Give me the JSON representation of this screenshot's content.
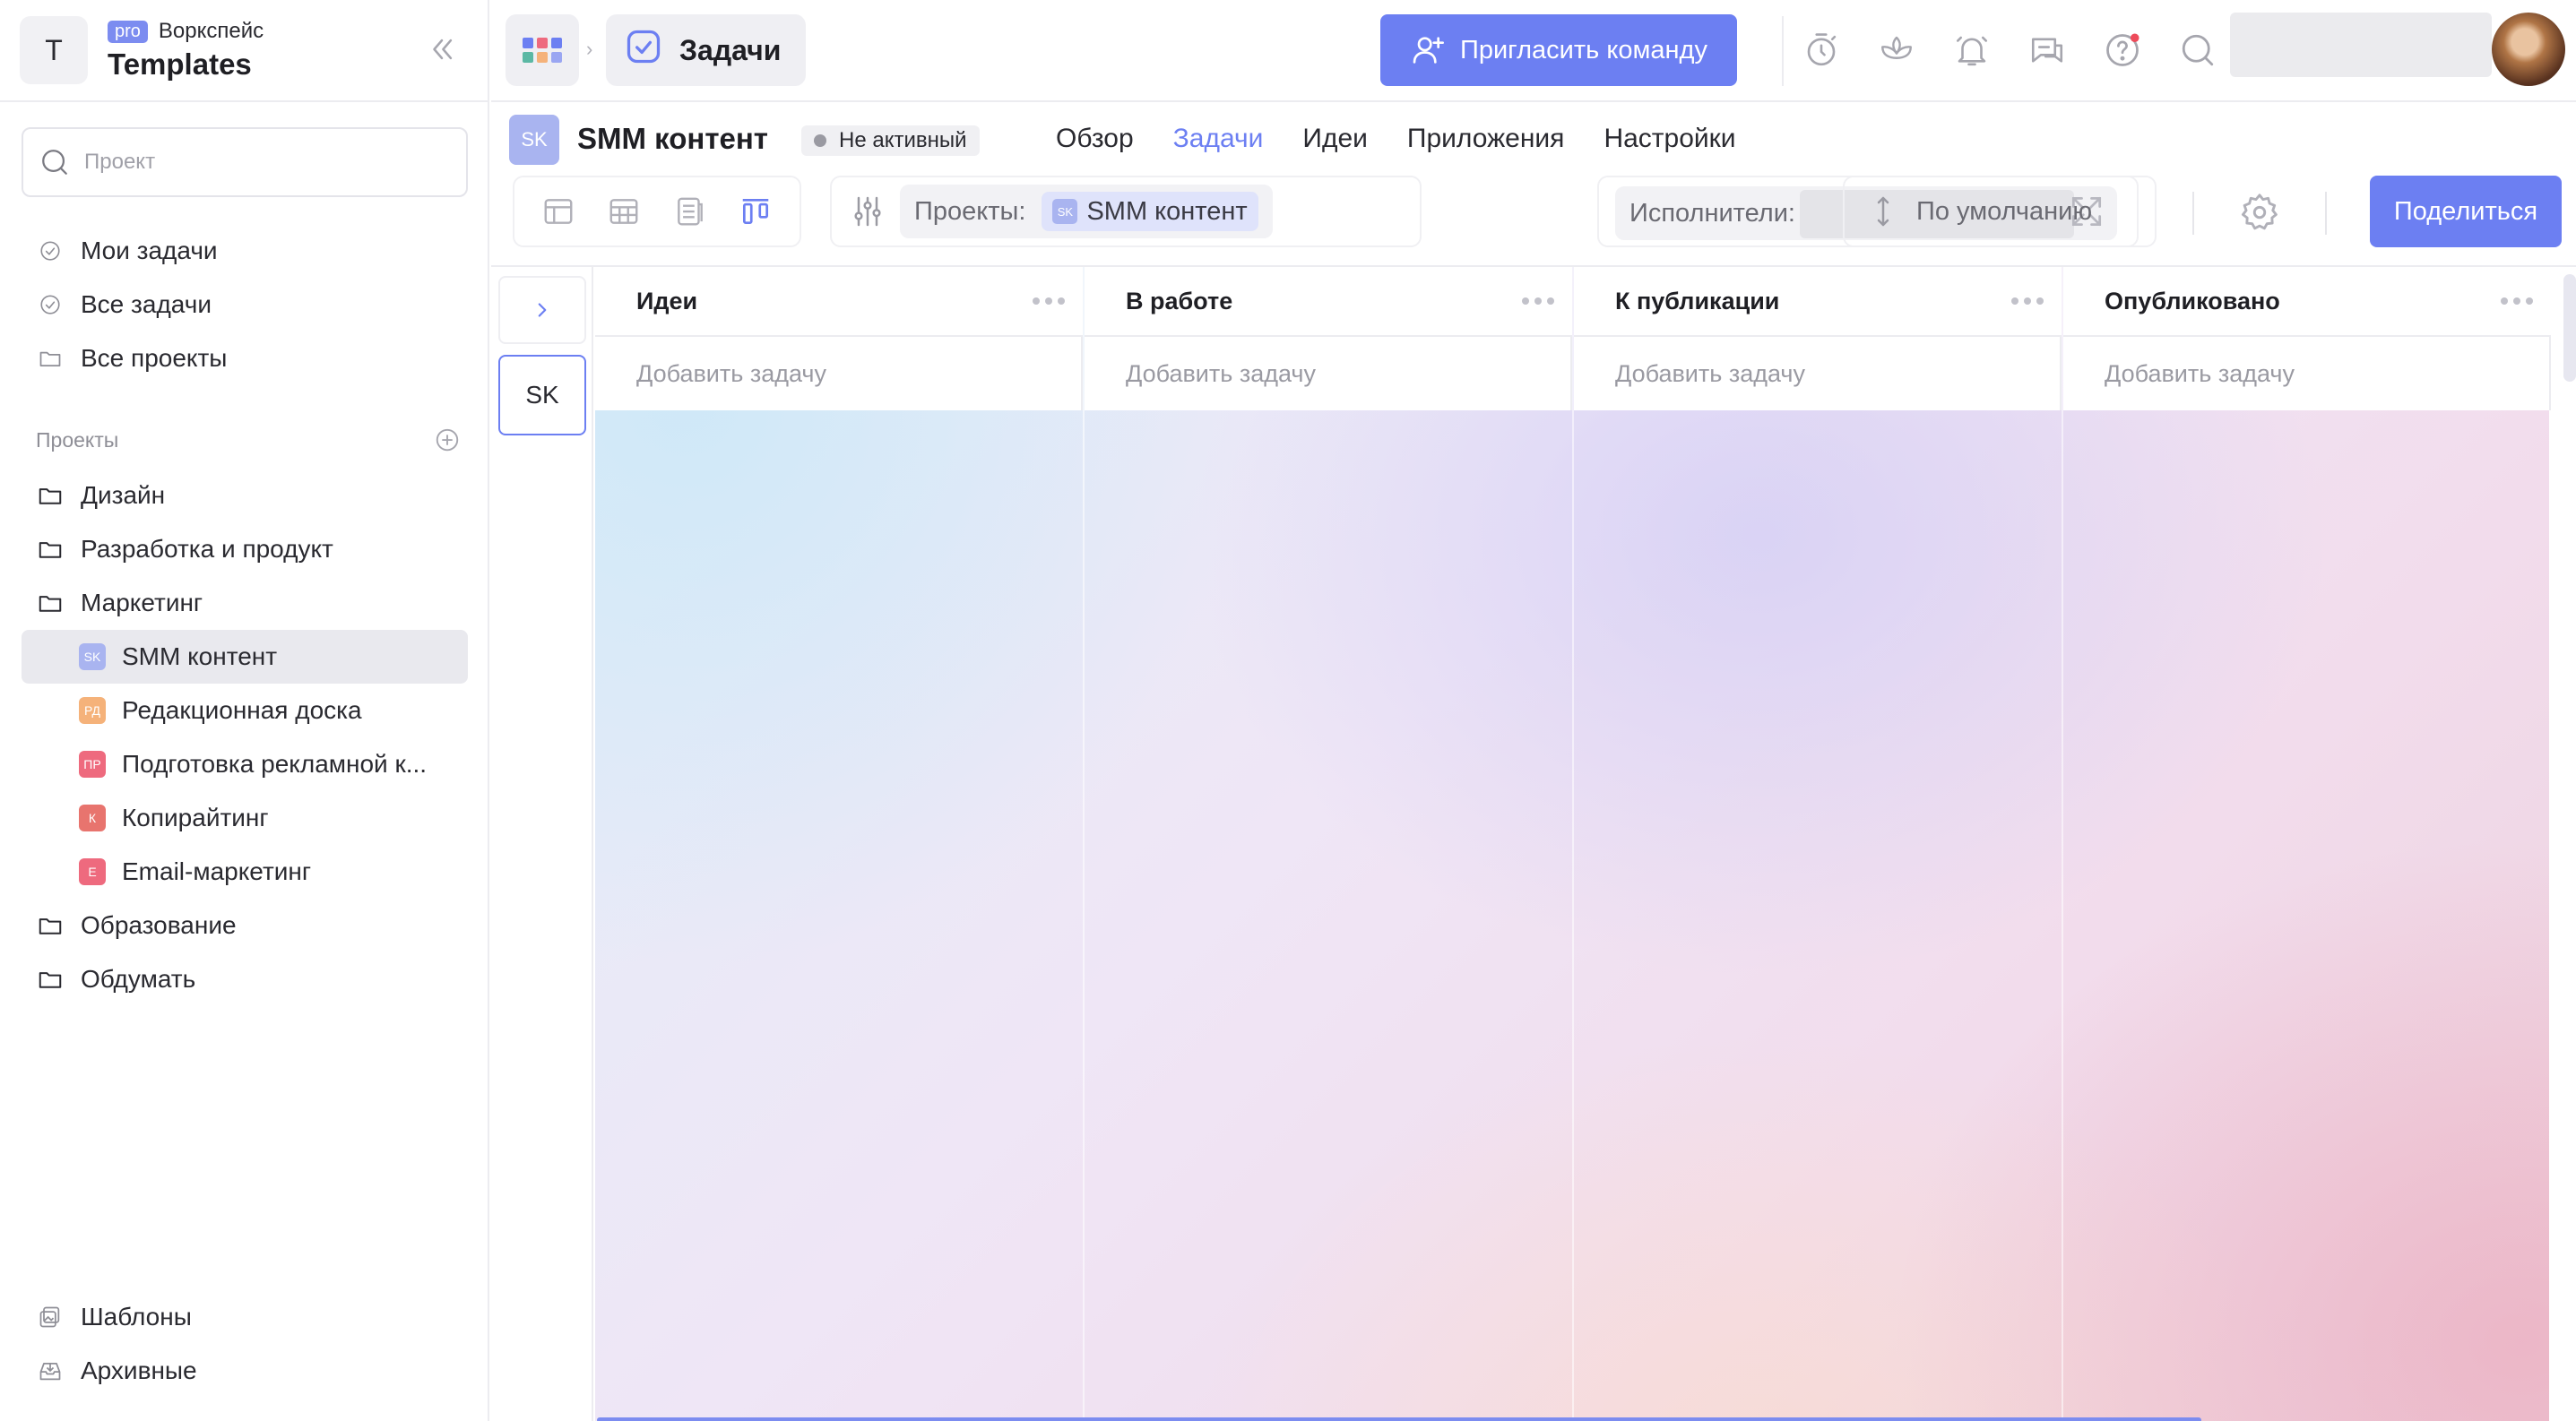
{
  "workspace": {
    "avatar_letter": "T",
    "badge": "pro",
    "label": "Воркспейс",
    "name": "Templates"
  },
  "sidebar": {
    "search_placeholder": "Проект",
    "nav": [
      {
        "label": "Мои задачи",
        "icon": "check-circle-icon"
      },
      {
        "label": "Все задачи",
        "icon": "check-circle-icon"
      },
      {
        "label": "Все проекты",
        "icon": "folder-icon"
      }
    ],
    "projects_title": "Проекты",
    "projects": [
      {
        "label": "Дизайн",
        "type": "folder"
      },
      {
        "label": "Разработка и продукт",
        "type": "folder"
      },
      {
        "label": "Маркетинг",
        "type": "folder"
      },
      {
        "label": "SMM контент",
        "type": "project",
        "badge": "SK",
        "color": "#a9b4f0",
        "active": true
      },
      {
        "label": "Редакционная доска",
        "type": "project",
        "badge": "РД",
        "color": "#f5b27a"
      },
      {
        "label": "Подготовка рекламной к...",
        "type": "project",
        "badge": "ПР",
        "color": "#ee6a7e"
      },
      {
        "label": "Копирайтинг",
        "type": "project",
        "badge": "К",
        "color": "#e8746e"
      },
      {
        "label": "Email-маркетинг",
        "type": "project",
        "badge": "E",
        "color": "#ee6a7e"
      },
      {
        "label": "Образование",
        "type": "folder"
      },
      {
        "label": "Обдумать",
        "type": "folder"
      }
    ],
    "bottom": [
      {
        "label": "Шаблоны",
        "icon": "templates-icon"
      },
      {
        "label": "Архивные",
        "icon": "archive-icon"
      }
    ]
  },
  "topbar": {
    "section_title": "Задачи",
    "invite_label": "Пригласить команду"
  },
  "project": {
    "badge": "SK",
    "title": "SMM контент",
    "status": "Не активный",
    "tabs": [
      "Обзор",
      "Задачи",
      "Идеи",
      "Приложения",
      "Настройки"
    ],
    "active_tab": "Задачи"
  },
  "toolbar": {
    "projects_label": "Проекты:",
    "project_chip_badge": "SK",
    "project_chip": "SMM контент",
    "assignees_label": "Исполнители:",
    "sort_label": "По умолчанию",
    "share_label": "Поделиться"
  },
  "board": {
    "mini_tile": "SK",
    "columns": [
      {
        "title": "Идеи",
        "add_label": "Добавить задачу"
      },
      {
        "title": "В работе",
        "add_label": "Добавить задачу"
      },
      {
        "title": "К публикации",
        "add_label": "Добавить задачу"
      },
      {
        "title": "Опубликовано",
        "add_label": "Добавить задачу"
      }
    ]
  },
  "colors": {
    "accent": "#6c7ff2",
    "notification_dot": "#ee4b5a"
  }
}
